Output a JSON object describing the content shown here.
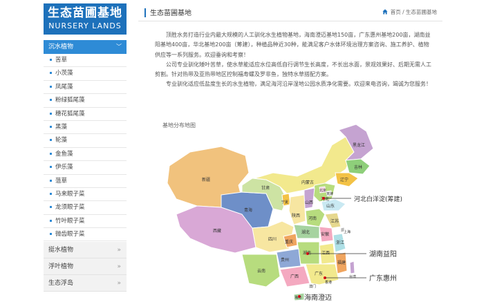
{
  "logo": {
    "cn": "生态苗圃基地",
    "en": "NURSERY LANDS"
  },
  "sidebar": {
    "active_category": "沉水植物",
    "items": [
      "苦草",
      "小茨藻",
      "凤尾藻",
      "粉绿狐尾藻",
      "穗花狐尾藻",
      "黑藻",
      "轮藻",
      "金鱼藻",
      "伊乐藻",
      "菹草",
      "马来眼子菜",
      "龙须眼子菜",
      "竹叶眼子菜",
      "微齿眼子菜"
    ],
    "collapsed_categories": [
      "挺水植物",
      "浮叶植物",
      "生态浮岛"
    ]
  },
  "header": {
    "title": "生态苗圃基地",
    "breadcrumb": "首页 / 生态苗圃基地"
  },
  "intro": [
    "顶胜水务打造行业内最大规模的人工驯化水生植物基地，海南澄迈基地150亩，广东惠州基地200亩，湖南益阳基地400亩，华北基地200亩（筹建），种植品种近30种，能满足客户水体环境治理方案咨询、施工养护、植物供应等一系列服务。欢迎垂询和考察！",
    "公司专业驯化矮叶苦草，使水草能适应水位高低自行调节生长高度，不长出水面，景观效果好、后期无需人工剪割。针对热带及亚热带地区控制福寿螺及罗非鱼，独特水草搭配方案。",
    "专业驯化适应低盐度生长的水生植物，满足海河沿岸湿地公园水质净化需要。欢迎来电咨询，竭诚为您服务！"
  ],
  "map": {
    "label": "基地分布地图",
    "provinces": [
      "新疆",
      "西藏",
      "青海",
      "甘肃",
      "内蒙古",
      "黑龙江",
      "吉林",
      "辽宁",
      "北京",
      "天津",
      "河北",
      "山西",
      "陕西",
      "宁夏",
      "山东",
      "河南",
      "江苏",
      "安徽",
      "上海",
      "湖北",
      "四川",
      "重庆",
      "湖南",
      "浙江",
      "江西",
      "福建",
      "贵州",
      "云南",
      "广西",
      "广东",
      "香港",
      "澳门",
      "海南",
      "台湾"
    ],
    "callouts": [
      "河北白洋淀(筹建)",
      "湖南益阳",
      "广东惠州",
      "海南澄迈"
    ]
  }
}
